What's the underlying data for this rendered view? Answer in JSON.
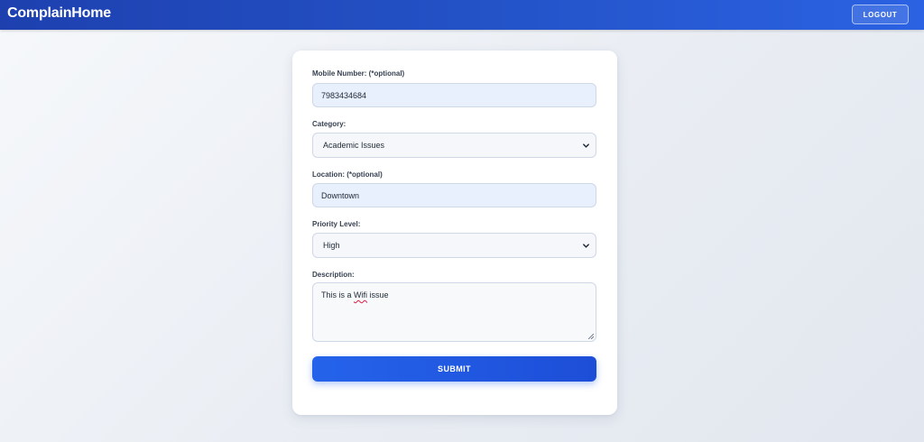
{
  "header": {
    "brand": "ComplainHome",
    "logout_label": "LOGOUT"
  },
  "form": {
    "mobile": {
      "label": "Mobile Number: (*optional)",
      "value": "7983434684"
    },
    "category": {
      "label": "Category:",
      "selected": "Academic Issues"
    },
    "location": {
      "label": "Location: (*optional)",
      "value": "Downtown"
    },
    "priority": {
      "label": "Priority Level:",
      "selected": "High"
    },
    "description": {
      "label": "Description:",
      "value_prefix": "This is a ",
      "value_misspelled": "Wifi",
      "value_suffix": " issue"
    },
    "submit_label": "SUBMIT"
  },
  "colors": {
    "navbar": "#1e40af",
    "accent": "#2563eb",
    "autofill_bg": "#e8effd"
  },
  "icons": [
    "chevron-down-icon",
    "resize-handle-icon"
  ]
}
